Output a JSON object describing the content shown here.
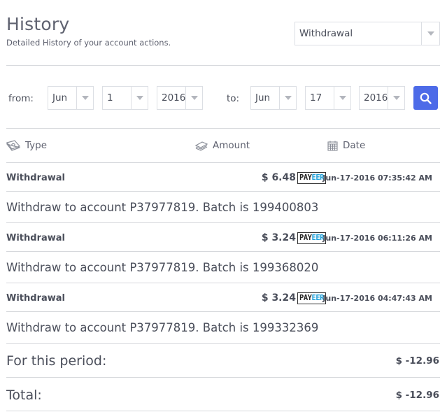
{
  "header": {
    "title": "History",
    "subtitle": "Detailed History of your account actions."
  },
  "type_filter": {
    "selected": "Withdrawal"
  },
  "filters": {
    "from_label": "from:",
    "to_label": "to:",
    "from_month": "Jun",
    "from_day": "1",
    "from_year": "2016",
    "to_month": "Jun",
    "to_day": "17",
    "to_year": "2016"
  },
  "columns": {
    "type": "Type",
    "amount": "Amount",
    "date": "Date"
  },
  "rows": [
    {
      "type": "Withdrawal",
      "amount": "$ 6.48",
      "payeer_a": "PAY",
      "payeer_b": "EER",
      "date": "Jun-17-2016 07:35:42 AM",
      "description": "Withdraw to account P37977819. Batch is 199400803"
    },
    {
      "type": "Withdrawal",
      "amount": "$ 3.24",
      "payeer_a": "PAY",
      "payeer_b": "EER",
      "date": "Jun-17-2016 06:11:26 AM",
      "description": "Withdraw to account P37977819. Batch is 199368020"
    },
    {
      "type": "Withdrawal",
      "amount": "$ 3.24",
      "payeer_a": "PAY",
      "payeer_b": "EER",
      "date": "Jun-17-2016 04:47:43 AM",
      "description": "Withdraw to account P37977819. Batch is 199332369"
    }
  ],
  "summary": {
    "period_label": "For this period:",
    "period_value": "$ -12.96",
    "total_label": "Total:",
    "total_value": "$ -12.96"
  },
  "colors": {
    "accent": "#4d6be8",
    "payeer_blue": "#1e9fd8"
  },
  "icons": {
    "type": "money-bill-icon",
    "amount": "money-stack-icon",
    "date": "calendar-icon",
    "search": "search-icon",
    "dropdown": "chevron-down-icon"
  }
}
